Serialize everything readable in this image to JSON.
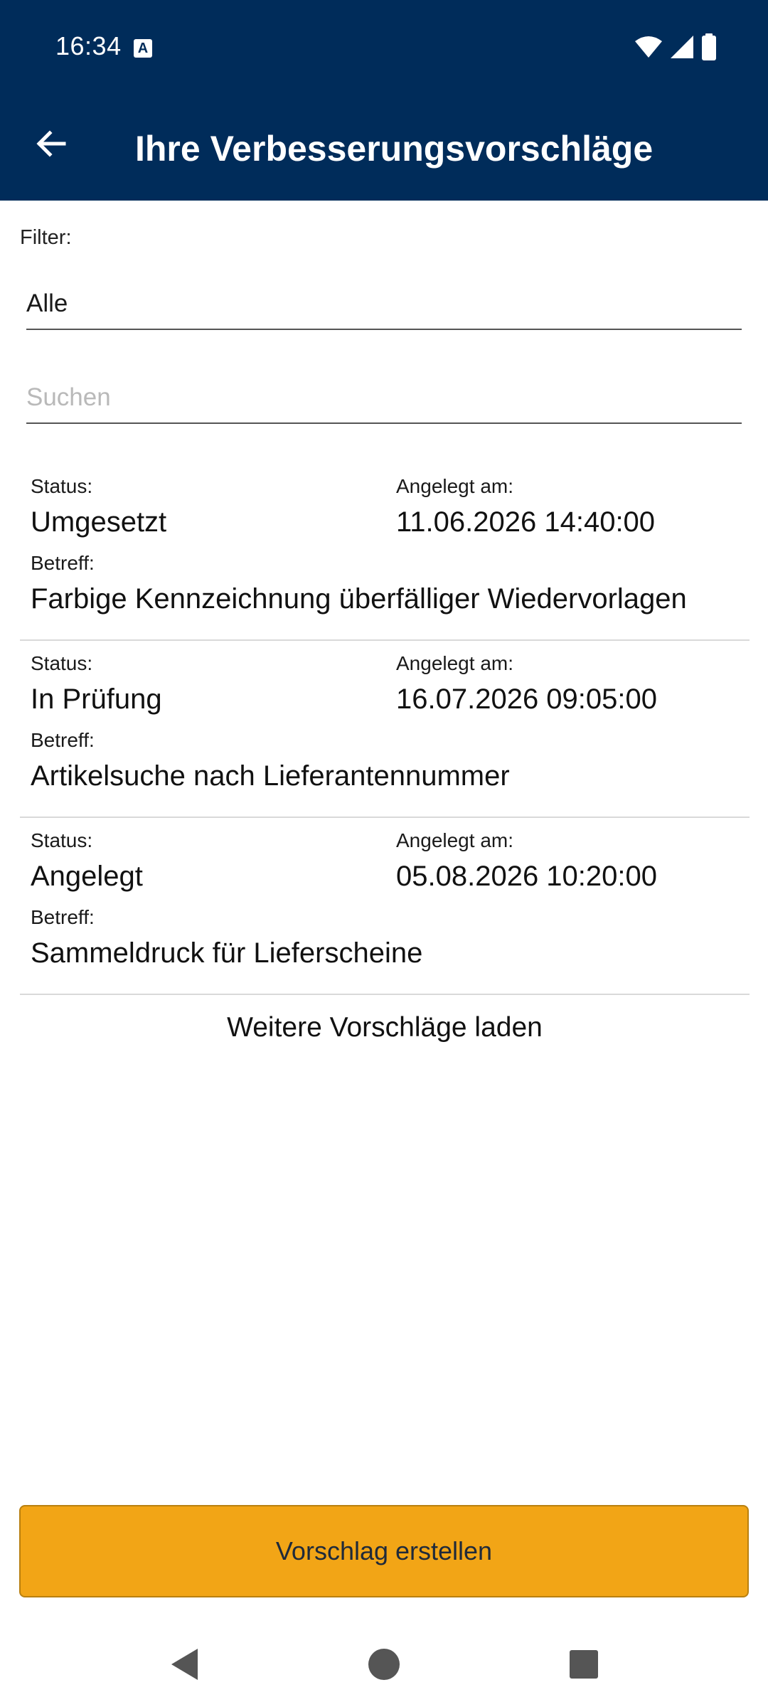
{
  "status_bar": {
    "time": "16:34",
    "notification_icon": "a-badge-icon",
    "icons": [
      "wifi-icon",
      "signal-icon",
      "battery-icon"
    ]
  },
  "app_bar": {
    "title": "Ihre Verbesserungsvorschläge",
    "back_icon": "arrow-left-icon",
    "background_color": "#002c5a"
  },
  "filter": {
    "label": "Filter:",
    "selected": "Alle"
  },
  "search": {
    "placeholder": "Suchen",
    "value": ""
  },
  "list": {
    "items": [
      {
        "status_label": "Status:",
        "status": "Umgesetzt",
        "date_label": "Angelegt am:",
        "date": "11.06.2026 14:40:00",
        "subject_label": "Betreff:",
        "subject": "Farbige Kennzeichnung überfälliger Wiedervorlagen"
      },
      {
        "status_label": "Status:",
        "status": "In Prüfung",
        "date_label": "Angelegt am:",
        "date": "16.07.2026 09:05:00",
        "subject_label": "Betreff:",
        "subject": "Artikelsuche nach Lieferantennummer"
      },
      {
        "status_label": "Status:",
        "status": "Angelegt",
        "date_label": "Angelegt am:",
        "date": "05.08.2026 10:20:00",
        "subject_label": "Betreff:",
        "subject": "Sammeldruck für Lieferscheine"
      }
    ],
    "load_more": "Weitere Vorschläge laden"
  },
  "actions": {
    "create_label": "Vorschlag erstellen",
    "create_color": "#f2a516"
  },
  "nav_bar": {
    "icons": [
      "nav-back-icon",
      "nav-home-icon",
      "nav-recents-icon"
    ]
  }
}
